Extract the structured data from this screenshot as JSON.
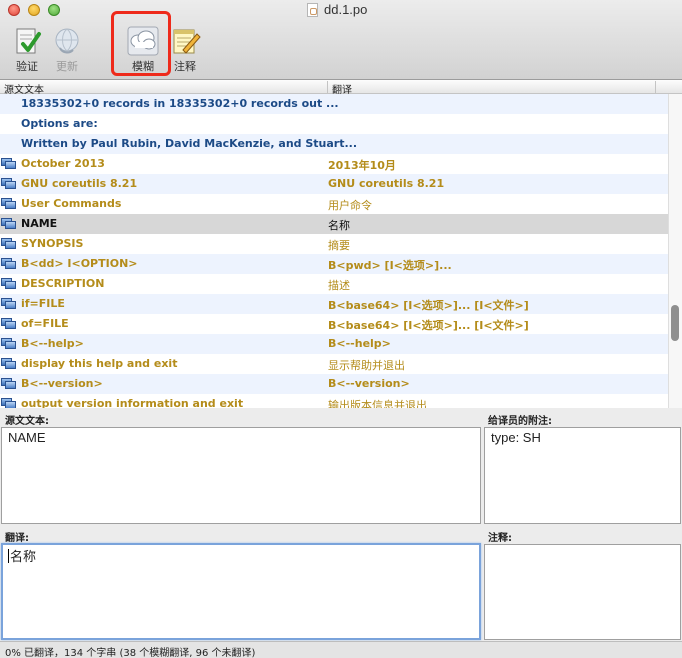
{
  "window": {
    "title": "dd.1.po"
  },
  "toolbar": {
    "validate_label": "验证",
    "update_label": "更新",
    "fuzzy_label": "模糊",
    "comment_label": "注释"
  },
  "columns": {
    "source": "源文文本",
    "translation": "翻译"
  },
  "rows": [
    {
      "source": "18335302+0 records in 18335302+0 records out ...",
      "translation": "",
      "status": "untranslated"
    },
    {
      "source": "Options are:",
      "translation": "",
      "status": "untranslated"
    },
    {
      "source": "Written by Paul Rubin, David MacKenzie, and Stuart...",
      "translation": "",
      "status": "untranslated"
    },
    {
      "source": "October 2013",
      "translation": "2013年10月",
      "status": "fuzzy"
    },
    {
      "source": "GNU coreutils 8.21",
      "translation": "GNU coreutils 8.21",
      "status": "fuzzy"
    },
    {
      "source": "User Commands",
      "translation": "用户命令",
      "status": "fuzzy"
    },
    {
      "source": "NAME",
      "translation": "名称",
      "status": "selected"
    },
    {
      "source": "SYNOPSIS",
      "translation": "摘要",
      "status": "fuzzy"
    },
    {
      "source": "B<dd> I<OPTION>",
      "translation": "B<pwd> [I<选项>]...",
      "status": "fuzzy"
    },
    {
      "source": "DESCRIPTION",
      "translation": "描述",
      "status": "fuzzy"
    },
    {
      "source": "if=FILE",
      "translation": "B<base64> [I<选项>]... [I<文件>]",
      "status": "fuzzy"
    },
    {
      "source": "of=FILE",
      "translation": "B<base64> [I<选项>]... [I<文件>]",
      "status": "fuzzy"
    },
    {
      "source": "B<--help>",
      "translation": "B<--help>",
      "status": "fuzzy"
    },
    {
      "source": "display this help and exit",
      "translation": "显示帮助并退出",
      "status": "fuzzy"
    },
    {
      "source": "B<--version>",
      "translation": "B<--version>",
      "status": "fuzzy"
    },
    {
      "source": "output version information and exit",
      "translation": "输出版本信息并退出",
      "status": "fuzzy"
    }
  ],
  "panels": {
    "source_label": "源文文本:",
    "source_text": "NAME",
    "notes_label": "给译员的附注:",
    "notes_text": "type: SH",
    "translation_label": "翻译:",
    "translation_text": "名称",
    "comment_label": "注释:",
    "comment_text": ""
  },
  "status": {
    "text": "0% 已翻译，134 个字串 (38 个模糊翻译, 96 个未翻译)"
  },
  "colors": {
    "fuzzy_text": "#b48c1a",
    "untranslated_text": "#1c4a86",
    "highlight": "#ee2a1b",
    "selected_row": "#d7d7d7"
  },
  "icons": {
    "validate": "checkmark-document-icon",
    "update": "globe-refresh-icon",
    "fuzzy": "cloud-icon",
    "comment": "notepad-pencil-icon",
    "row_status": "computer-icon"
  }
}
